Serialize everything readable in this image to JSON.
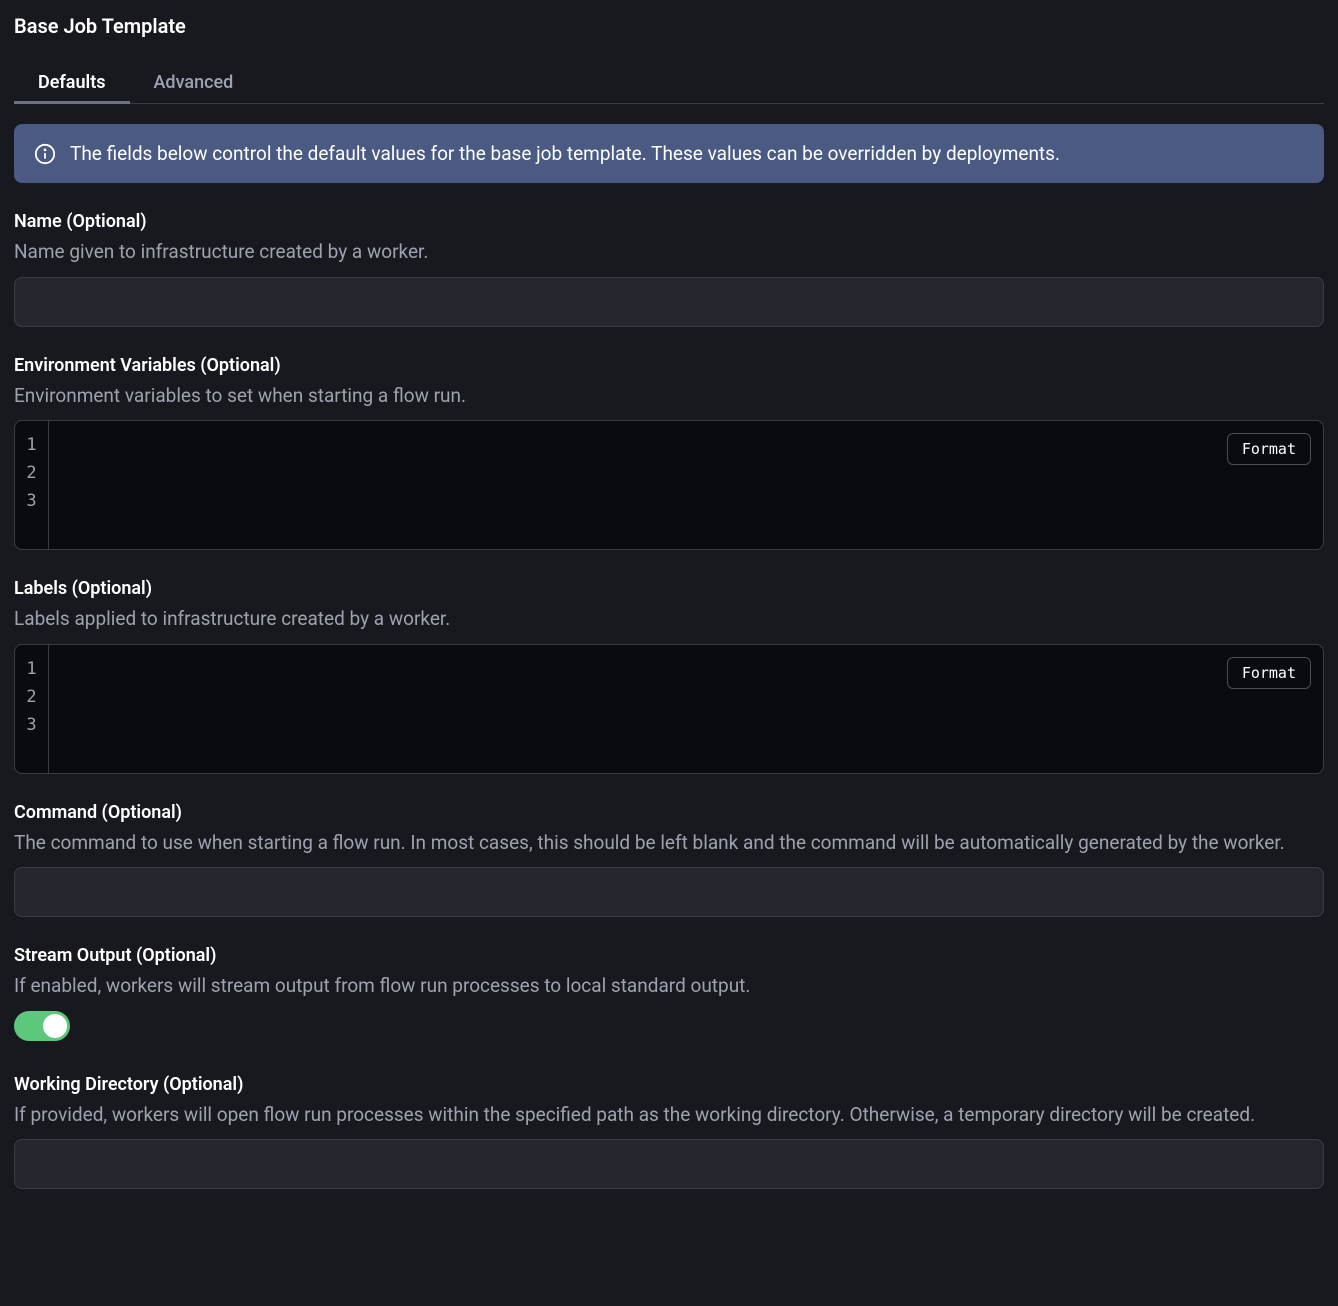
{
  "title": "Base Job Template",
  "tabs": {
    "defaults": "Defaults",
    "advanced": "Advanced"
  },
  "banner": {
    "text": "The fields below control the default values for the base job template. These values can be overridden by deployments."
  },
  "fields": {
    "name": {
      "label": "Name (Optional)",
      "description": "Name given to infrastructure created by a worker.",
      "value": ""
    },
    "env": {
      "label": "Environment Variables (Optional)",
      "description": "Environment variables to set when starting a flow run.",
      "format_button": "Format",
      "lines": [
        "1",
        "2",
        "3"
      ]
    },
    "labels": {
      "label": "Labels (Optional)",
      "description": "Labels applied to infrastructure created by a worker.",
      "format_button": "Format",
      "lines": [
        "1",
        "2",
        "3"
      ]
    },
    "command": {
      "label": "Command (Optional)",
      "description": "The command to use when starting a flow run. In most cases, this should be left blank and the command will be automatically generated by the worker.",
      "value": ""
    },
    "stream_output": {
      "label": "Stream Output (Optional)",
      "description": "If enabled, workers will stream output from flow run processes to local standard output.",
      "enabled": true
    },
    "working_directory": {
      "label": "Working Directory (Optional)",
      "description": "If provided, workers will open flow run processes within the specified path as the working directory. Otherwise, a temporary directory will be created.",
      "value": ""
    }
  }
}
